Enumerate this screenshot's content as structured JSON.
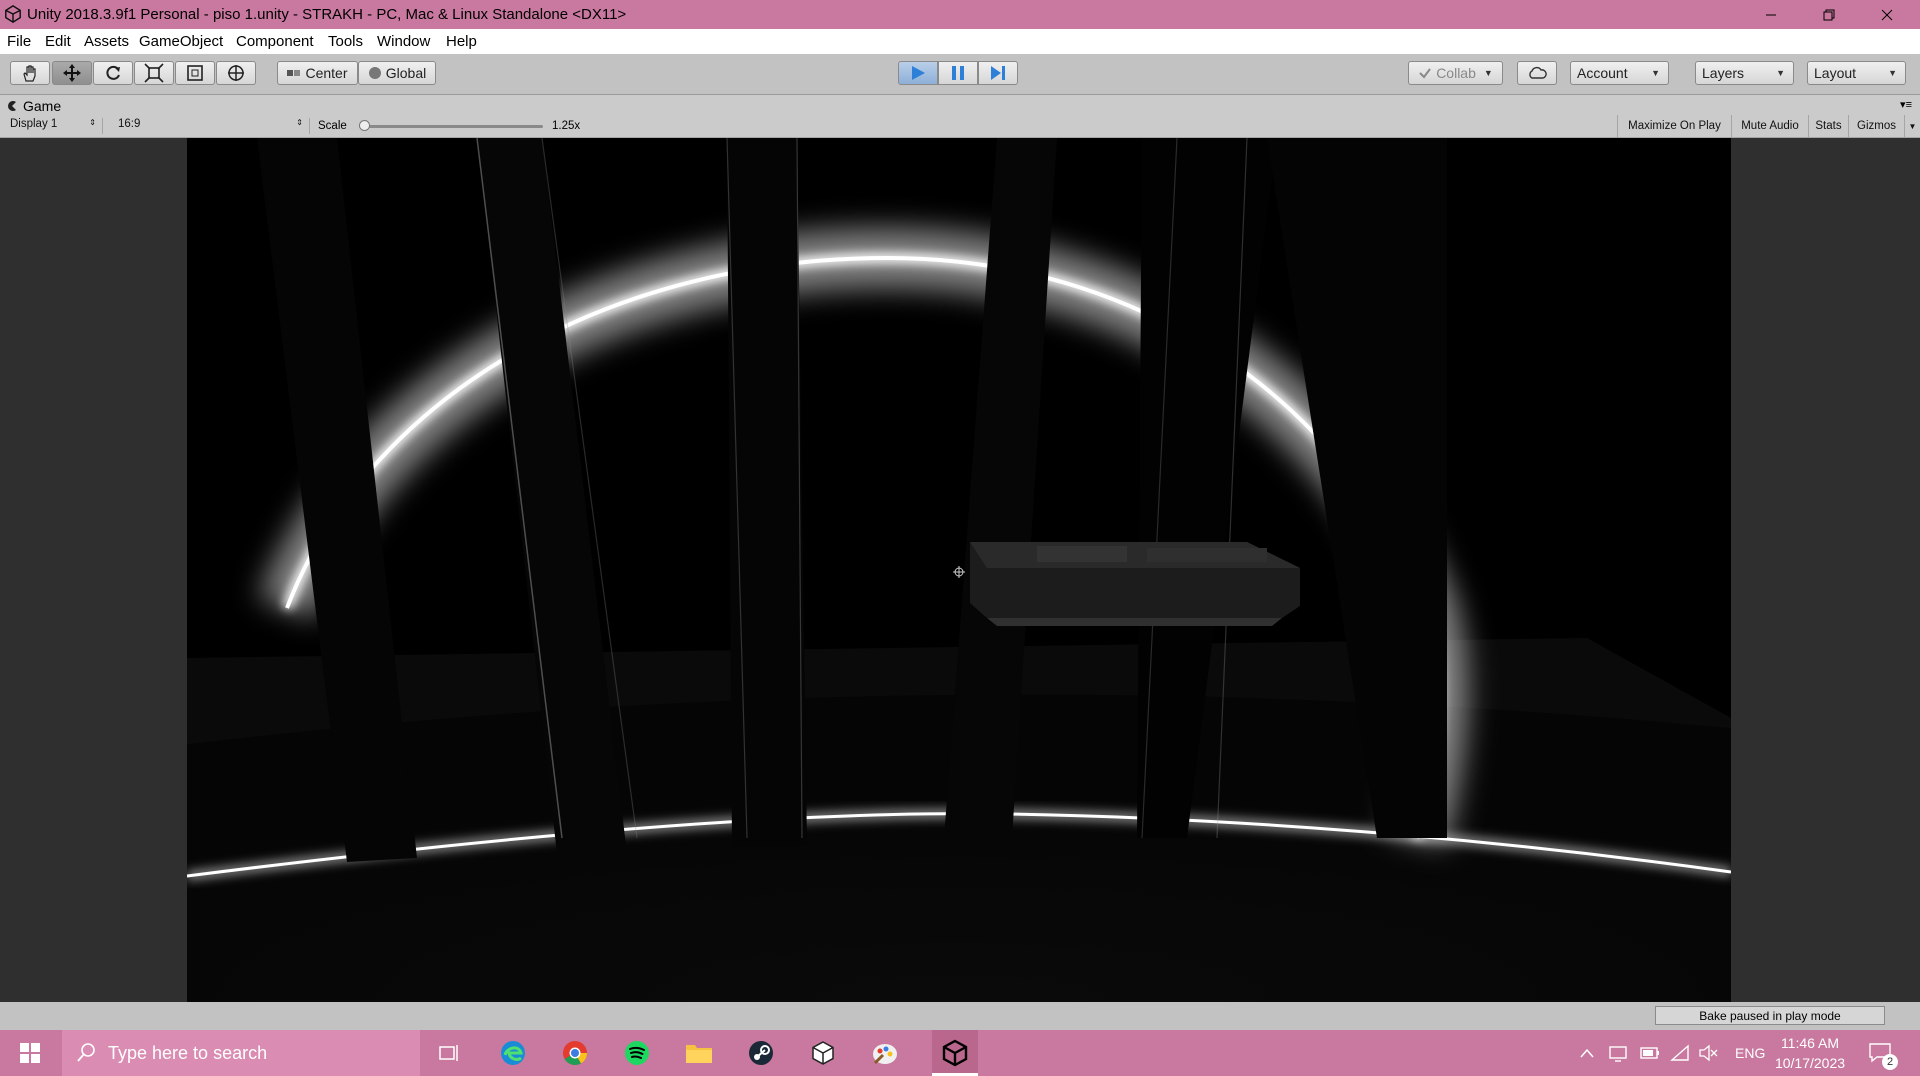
{
  "window": {
    "title": "Unity 2018.3.9f1 Personal - piso 1.unity - STRAKH - PC, Mac & Linux Standalone <DX11>"
  },
  "menu": [
    "File",
    "Edit",
    "Assets",
    "GameObject",
    "Component",
    "Tools",
    "Window",
    "Help"
  ],
  "toolbar": {
    "pivot_label": "Center",
    "space_label": "Global",
    "collab_label": "Collab",
    "account_label": "Account",
    "layers_label": "Layers",
    "layout_label": "Layout",
    "play_active": true
  },
  "game_view": {
    "tab_label": "Game",
    "display": "Display 1",
    "aspect": "16:9",
    "scale_label": "Scale",
    "scale_value": "1.25x",
    "scale_slider_fraction": 0.0,
    "maximize_on_play": "Maximize On Play",
    "mute_audio": "Mute Audio",
    "stats": "Stats",
    "gizmos": "Gizmos"
  },
  "status": {
    "bake_message": "Bake paused in play mode"
  },
  "taskbar": {
    "search_placeholder": "Type here to search",
    "pinned": [
      "task-view-icon",
      "edge-icon",
      "chrome-icon",
      "spotify-icon",
      "file-explorer-icon",
      "steam-icon",
      "unity-hub-icon",
      "paint-icon",
      "unity-icon"
    ],
    "language": "ENG",
    "time": "11:46 AM",
    "date": "10/17/2023",
    "notification_count": "2"
  },
  "colors": {
    "titlebar": "#c9799f",
    "taskbar": "#c9799f",
    "toolbar": "#c2c2c2",
    "play_active": "#8eafd7",
    "game_background": "#000000"
  }
}
